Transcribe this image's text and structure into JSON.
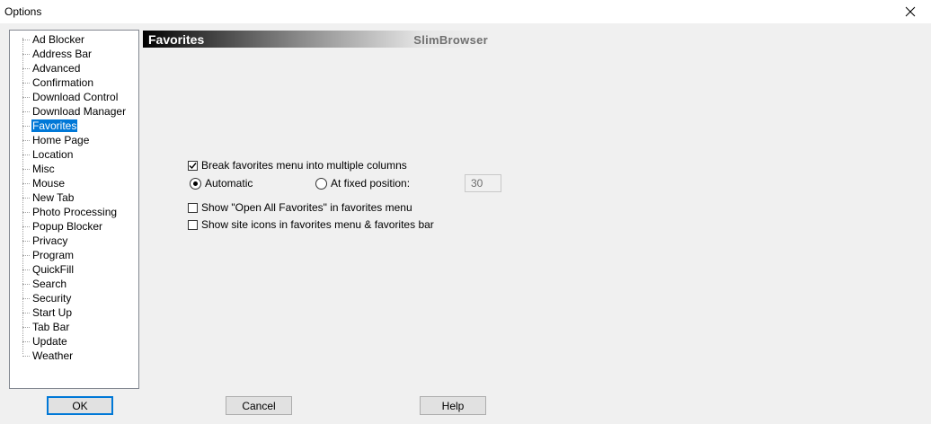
{
  "window": {
    "title": "Options"
  },
  "tree": {
    "selected": "Favorites",
    "items": [
      "Ad Blocker",
      "Address Bar",
      "Advanced",
      "Confirmation",
      "Download Control",
      "Download Manager",
      "Favorites",
      "Home Page",
      "Location",
      "Misc",
      "Mouse",
      "New Tab",
      "Photo Processing",
      "Popup Blocker",
      "Privacy",
      "Program",
      "QuickFill",
      "Search",
      "Security",
      "Start Up",
      "Tab Bar",
      "Update",
      "Weather"
    ]
  },
  "panel": {
    "title": "Favorites",
    "brand": "SlimBrowser",
    "break_columns": {
      "label": "Break favorites menu into multiple columns",
      "checked": true
    },
    "automatic": {
      "label": "Automatic",
      "selected": true
    },
    "fixed_position": {
      "label": "At fixed position:",
      "selected": false,
      "value": "30"
    },
    "show_open_all": {
      "label": "Show \"Open All Favorites\" in favorites menu",
      "checked": false
    },
    "show_site_icons": {
      "label": "Show site icons in favorites menu & favorites bar",
      "checked": false
    }
  },
  "buttons": {
    "ok": "OK",
    "cancel": "Cancel",
    "help": "Help"
  },
  "colors": {
    "selection": "#0078d7",
    "focus_border": "#0078d7"
  }
}
